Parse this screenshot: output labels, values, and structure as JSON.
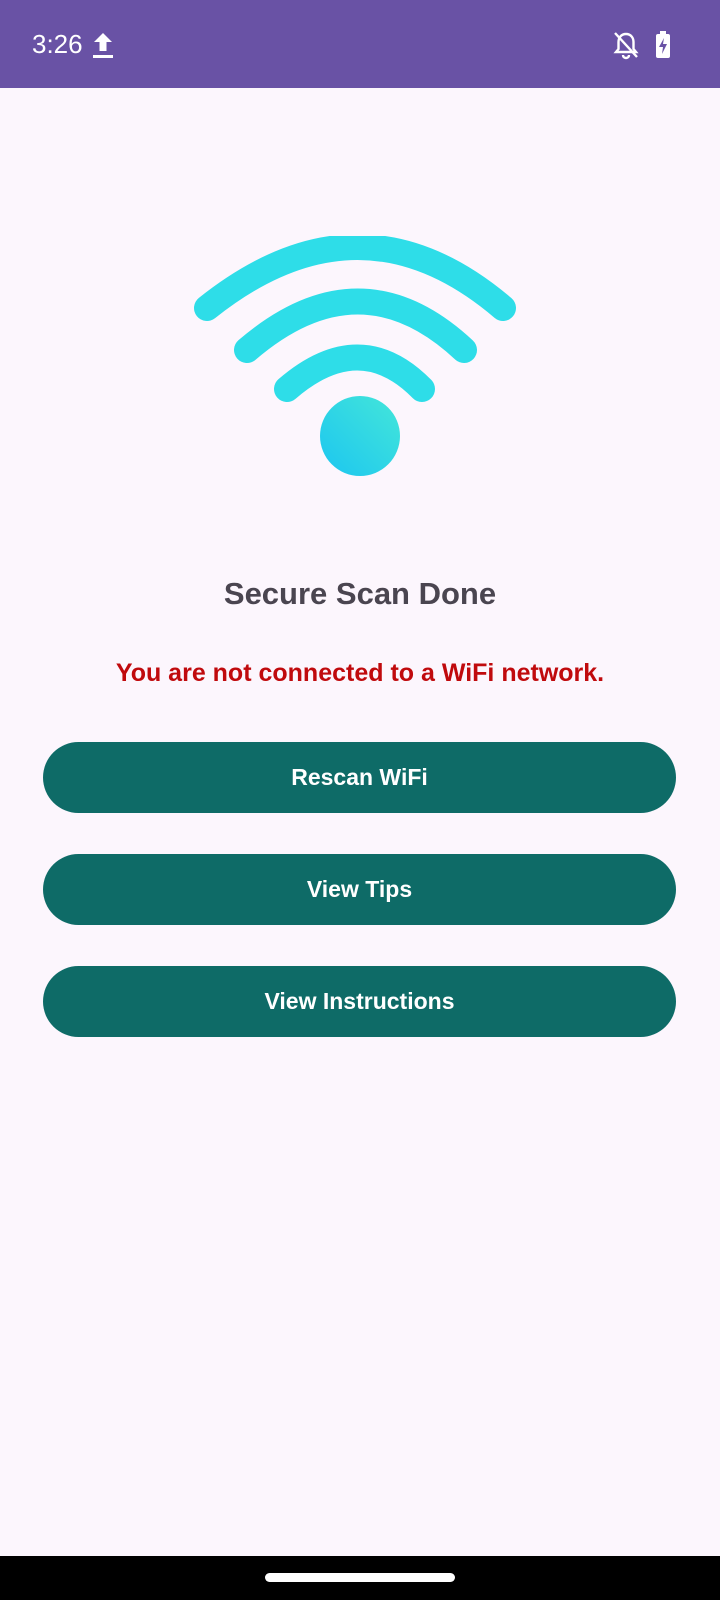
{
  "status_bar": {
    "time": "3:26",
    "icons": [
      "upload-icon",
      "bell-off-icon",
      "battery-charging-icon"
    ],
    "background_color": "#6952a5"
  },
  "main": {
    "illustration_icon": "wifi-icon",
    "title": "Secure Scan Done",
    "warning": "You are not connected to a WiFi network.",
    "buttons": [
      {
        "label": "Rescan WiFi"
      },
      {
        "label": "View Tips"
      },
      {
        "label": "View Instructions"
      }
    ]
  },
  "colors": {
    "background": "#fcf6fd",
    "button": "#0e6b67",
    "button_text": "#ffffff",
    "warning": "#c00a0d",
    "title": "#4a4550",
    "wifi_arcs": "#2edde8",
    "wifi_dot_start": "#44e6d9",
    "wifi_dot_end": "#1cc6f0"
  },
  "nav_bar": {
    "icons": [
      "home-handle"
    ]
  }
}
